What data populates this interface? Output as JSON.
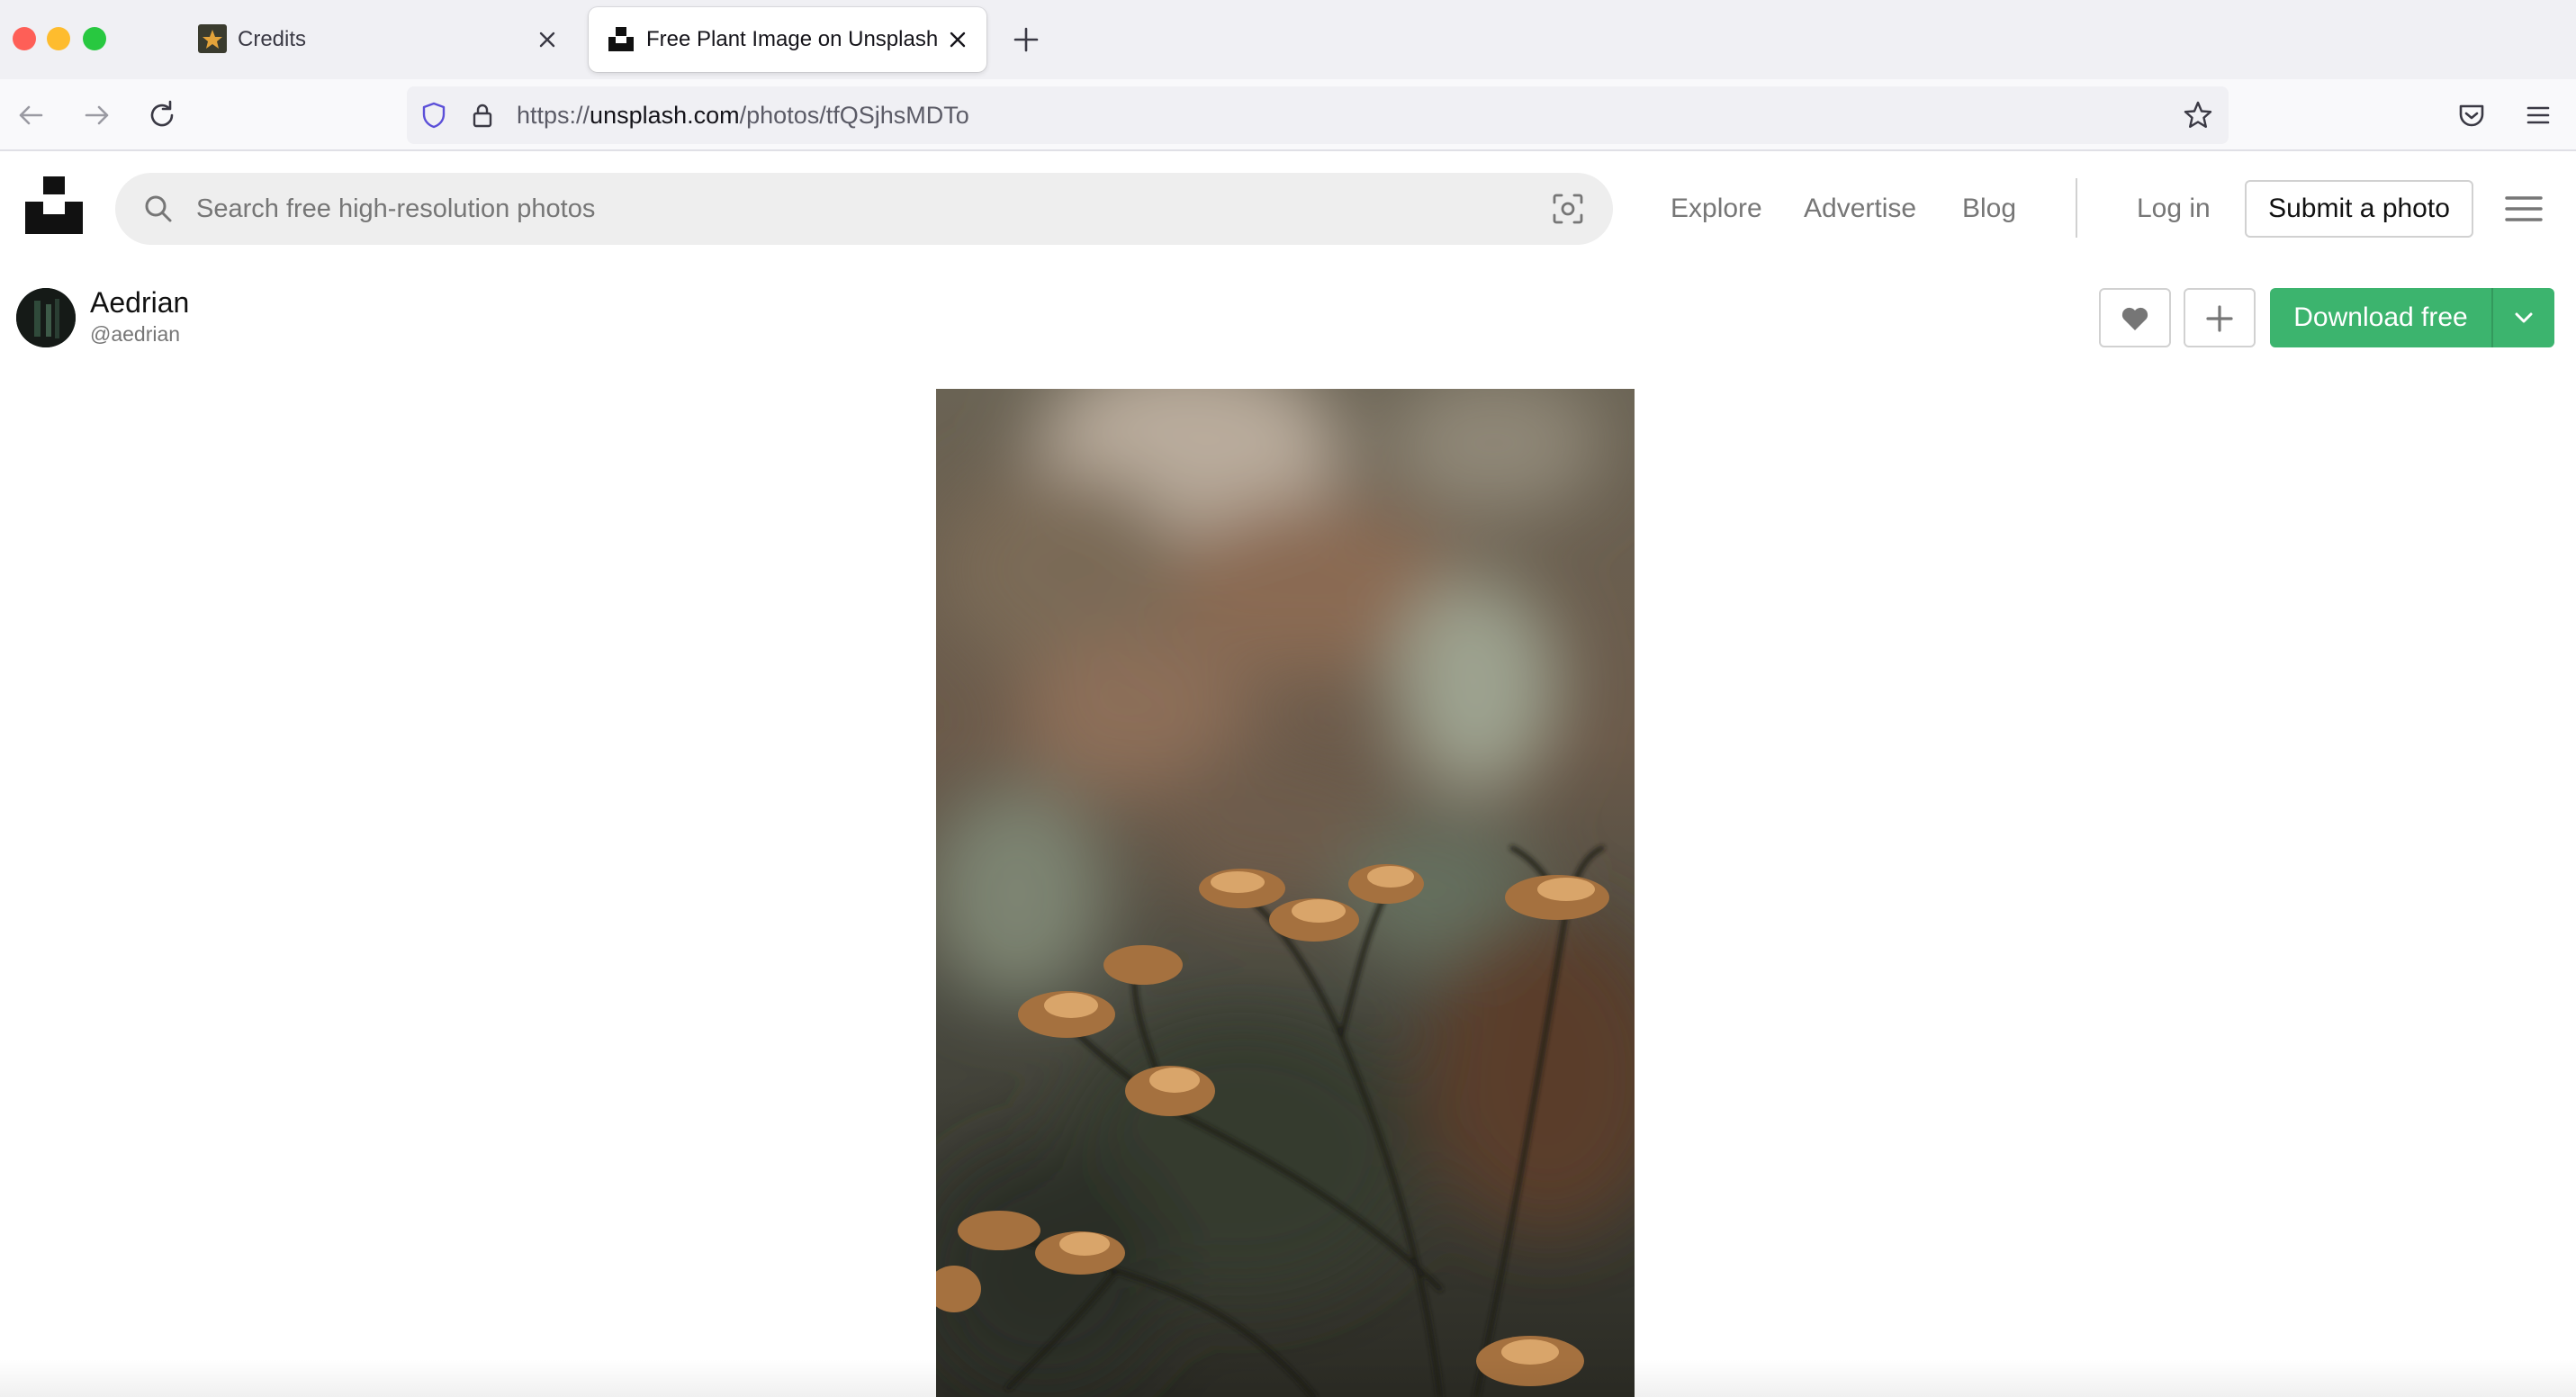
{
  "browser": {
    "tabs": [
      {
        "title": "Credits",
        "active": false,
        "favicon": "credits-favicon"
      },
      {
        "title": "Free Plant Image on Unsplash",
        "active": true,
        "favicon": "unsplash-favicon"
      }
    ],
    "url": {
      "scheme": "https://",
      "host": "unsplash.com",
      "path": "/photos/tfQSjhsMDTo"
    }
  },
  "site": {
    "search_placeholder": "Search free high-resolution photos",
    "nav": {
      "explore": "Explore",
      "advertise": "Advertise",
      "blog": "Blog"
    },
    "login": "Log in",
    "submit": "Submit a photo"
  },
  "photo_page": {
    "photographer": {
      "name": "Aedrian",
      "handle": "@aedrian"
    },
    "download_label": "Download free",
    "photo_alt": "Dried plant with brown flower heads against a blurred background"
  },
  "colors": {
    "accent_green": "#3cb46e",
    "text_primary": "#111111",
    "text_muted": "#767676",
    "search_bg": "#eeeeee"
  }
}
